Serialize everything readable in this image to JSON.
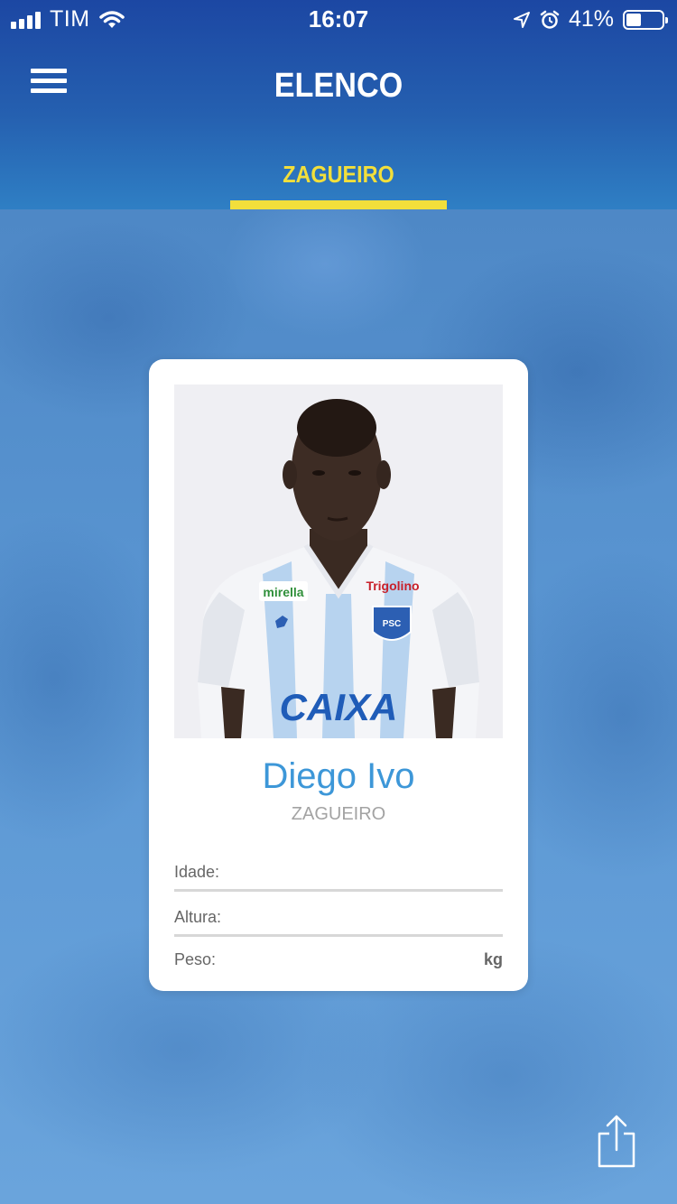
{
  "status_bar": {
    "carrier": "TIM",
    "time": "16:07",
    "battery_percent_text": "41%",
    "battery_level": 0.41
  },
  "header": {
    "title": "ELENCO",
    "tab_label": "ZAGUEIRO"
  },
  "player": {
    "name": "Diego Ivo",
    "position": "ZAGUEIRO",
    "fields": {
      "age_label": "Idade:",
      "height_label": "Altura:",
      "weight_label": "Peso:",
      "weight_unit": "kg"
    },
    "photo_text": {
      "sponsor_left": "mirella",
      "sponsor_right": "Trigolino",
      "main_sponsor": "CAIXA",
      "crest": "PSC"
    }
  },
  "colors": {
    "header_top": "#1c47a3",
    "header_bottom": "#2f7fc4",
    "tab_accent": "#f2df3b",
    "name_blue": "#3d97d8",
    "background_blue": "#5b93cf"
  },
  "icons": {
    "menu": "hamburger-menu-icon",
    "share": "share-icon",
    "wifi": "wifi-icon",
    "location": "location-arrow-icon",
    "alarm": "alarm-icon",
    "battery": "battery-icon"
  }
}
